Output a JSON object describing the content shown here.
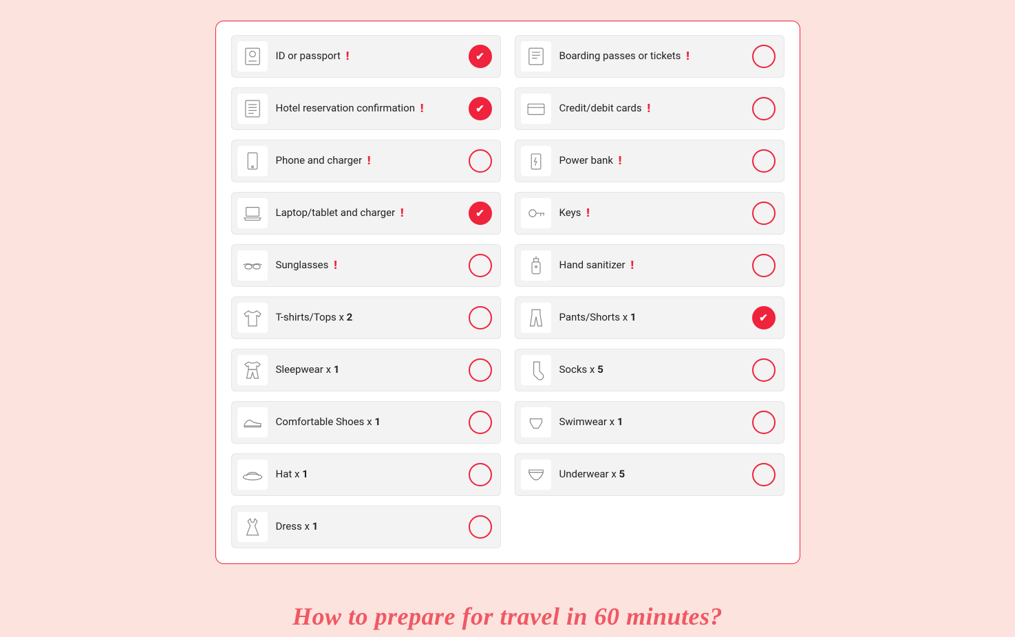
{
  "items": [
    {
      "label": "ID or passport",
      "important": true,
      "checked": true,
      "icon": "passport"
    },
    {
      "label": "Boarding passes or tickets",
      "important": true,
      "checked": false,
      "icon": "ticket"
    },
    {
      "label": "Hotel reservation confirmation",
      "important": true,
      "checked": true,
      "icon": "hotel-doc"
    },
    {
      "label": "Credit/debit cards",
      "important": true,
      "checked": false,
      "icon": "card"
    },
    {
      "label": "Phone and charger",
      "important": true,
      "checked": false,
      "icon": "phone"
    },
    {
      "label": "Power bank",
      "important": true,
      "checked": false,
      "icon": "powerbank"
    },
    {
      "label": "Laptop/tablet and charger",
      "important": true,
      "checked": true,
      "icon": "laptop"
    },
    {
      "label": "Keys",
      "important": true,
      "checked": false,
      "icon": "keys"
    },
    {
      "label": "Sunglasses",
      "important": true,
      "checked": false,
      "icon": "sunglasses"
    },
    {
      "label": "Hand sanitizer",
      "important": true,
      "checked": false,
      "icon": "sanitizer"
    },
    {
      "label": "T-shirts/Tops",
      "qty": 2,
      "checked": false,
      "icon": "tshirt"
    },
    {
      "label": "Pants/Shorts",
      "qty": 1,
      "checked": true,
      "icon": "pants"
    },
    {
      "label": "Sleepwear",
      "qty": 1,
      "checked": false,
      "icon": "sleepwear"
    },
    {
      "label": "Socks",
      "qty": 5,
      "checked": false,
      "icon": "socks"
    },
    {
      "label": "Comfortable Shoes",
      "qty": 1,
      "checked": false,
      "icon": "shoes"
    },
    {
      "label": "Swimwear",
      "qty": 1,
      "checked": false,
      "icon": "swimwear"
    },
    {
      "label": "Hat",
      "qty": 1,
      "checked": false,
      "icon": "hat"
    },
    {
      "label": "Underwear",
      "qty": 5,
      "checked": false,
      "icon": "underwear"
    },
    {
      "label": "Dress",
      "qty": 1,
      "checked": false,
      "icon": "dress"
    }
  ],
  "footer_heading": "How to prepare for travel in 60 minutes?"
}
